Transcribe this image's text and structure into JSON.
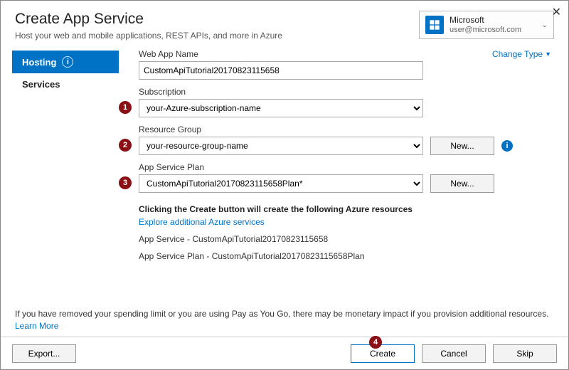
{
  "header": {
    "title": "Create App Service",
    "subtitle": "Host your web and mobile applications, REST APIs, and more in Azure"
  },
  "account": {
    "name": "Microsoft",
    "email": "user@microsoft.com"
  },
  "tabs": {
    "hosting": "Hosting",
    "services": "Services"
  },
  "form": {
    "webapp_label": "Web App Name",
    "change_type": "Change Type",
    "webapp_value": "CustomApiTutorial20170823115658",
    "subscription_label": "Subscription",
    "subscription_value": "your-Azure-subscription-name",
    "rg_label": "Resource Group",
    "rg_value": "your-resource-group-name",
    "plan_label": "App Service Plan",
    "plan_value": "CustomApiTutorial20170823115658Plan*",
    "new_btn": "New..."
  },
  "summary": {
    "heading": "Clicking the Create button will create the following Azure resources",
    "explore": "Explore additional Azure services",
    "res1": "App Service - CustomApiTutorial20170823115658",
    "res2": "App Service Plan - CustomApiTutorial20170823115658Plan"
  },
  "warning": {
    "text": "If you have removed your spending limit or you are using Pay as You Go, there may be monetary impact if you provision additional resources.",
    "learn_more": "Learn More"
  },
  "footer": {
    "export": "Export...",
    "create": "Create",
    "cancel": "Cancel",
    "skip": "Skip"
  },
  "badges": {
    "b1": "1",
    "b2": "2",
    "b3": "3",
    "b4": "4"
  }
}
